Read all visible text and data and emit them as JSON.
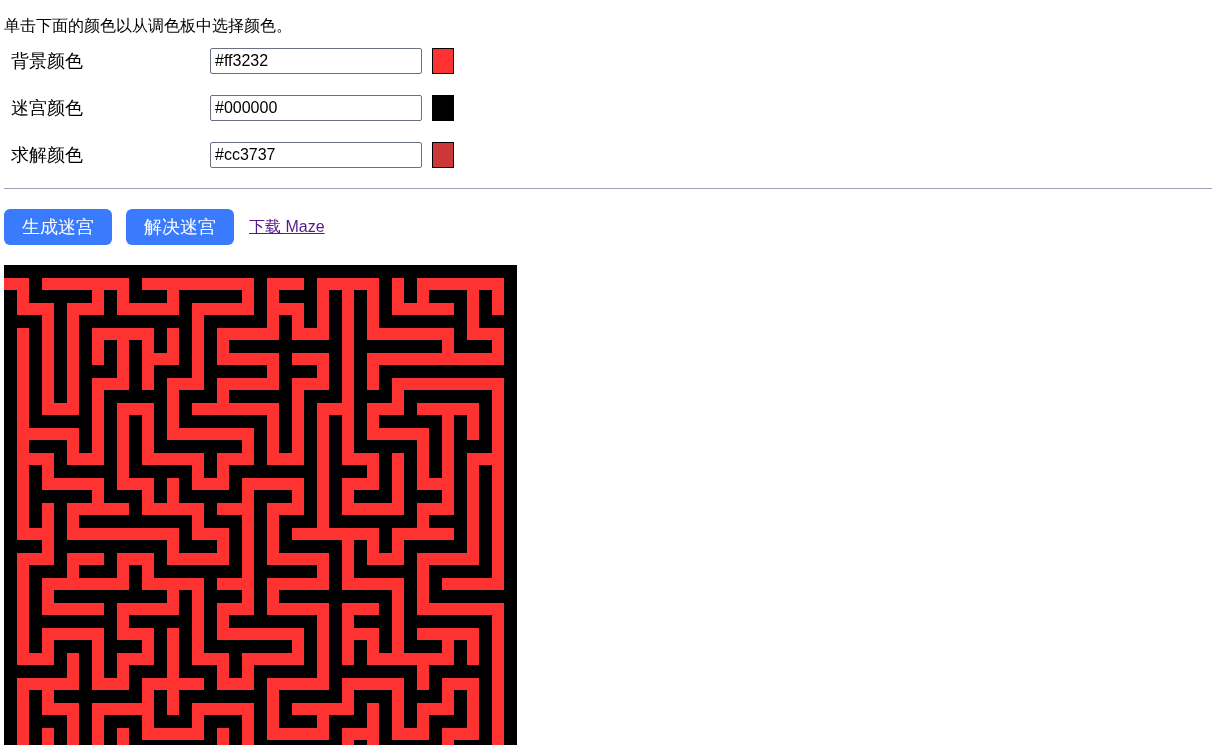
{
  "instructions": "单击下面的颜色以从调色板中选择颜色。",
  "color_settings": [
    {
      "label": "背景颜色",
      "value": "#ff3232",
      "color": "#ff3232"
    },
    {
      "label": "迷宫颜色",
      "value": "#000000",
      "color": "#000000"
    },
    {
      "label": "求解颜色",
      "value": "#cc3737",
      "color": "#cc3737"
    }
  ],
  "buttons": [
    "生成迷宫",
    "解决迷宫"
  ],
  "download_link": "下载 Maze"
}
